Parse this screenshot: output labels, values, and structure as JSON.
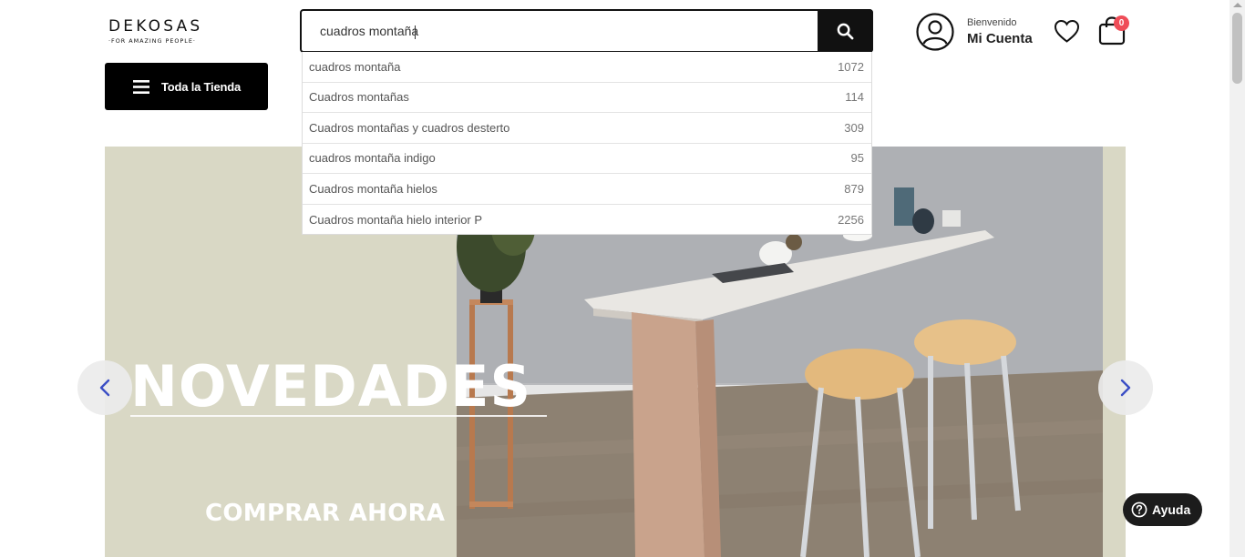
{
  "brand": {
    "name": "DEKOSAS",
    "tagline": "·FOR AMAZING PEOPLE·"
  },
  "search": {
    "value": "cuadros montaña",
    "placeholder": ""
  },
  "suggestions": [
    {
      "label": "cuadros montaña",
      "count": "1072"
    },
    {
      "label": "Cuadros montañas",
      "count": "114"
    },
    {
      "label": "Cuadros montañas y cuadros desterto",
      "count": "309"
    },
    {
      "label": "cuadros montaña indigo",
      "count": "95"
    },
    {
      "label": "Cuadros montaña hielos",
      "count": "879"
    },
    {
      "label": "Cuadros montaña hielo interior P",
      "count": "2256"
    }
  ],
  "account": {
    "welcome": "Bienvenido",
    "name": "Mi Cuenta"
  },
  "cart": {
    "count": "0"
  },
  "nav": {
    "store_label": "Toda la Tienda"
  },
  "hero": {
    "title": "NOVEDADES",
    "cta": "COMPRAR AHORA"
  },
  "help": {
    "label": "Ayuda"
  },
  "colors": {
    "primary": "#111111",
    "badge": "#ef4d58",
    "hero_bg": "#d9d8c5",
    "arrow": "#3b4ec5"
  },
  "icons": [
    "search-icon",
    "user-icon",
    "heart-icon",
    "cart-icon",
    "menu-icon",
    "chevron-left-icon",
    "chevron-right-icon",
    "question-icon"
  ]
}
